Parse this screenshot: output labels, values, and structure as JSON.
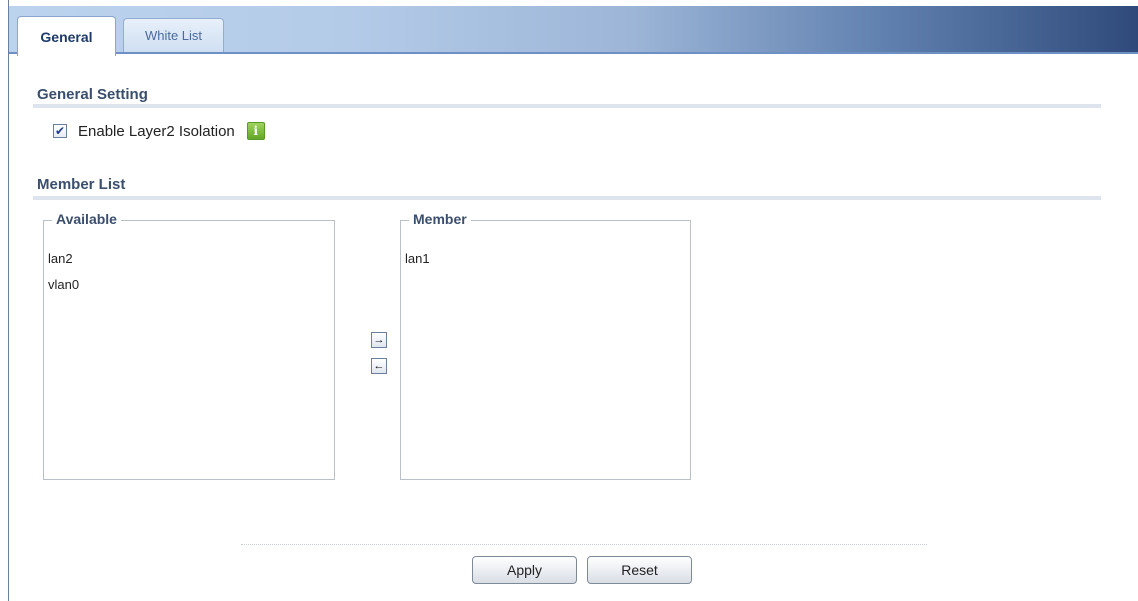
{
  "tabs": [
    {
      "label": "General",
      "active": true
    },
    {
      "label": "White List",
      "active": false
    }
  ],
  "general_setting": {
    "title": "General Setting",
    "enable_label": "Enable Layer2 Isolation",
    "enabled": true,
    "info_icon": "i"
  },
  "member_list": {
    "title": "Member List",
    "available": {
      "legend": "Available",
      "items": [
        "lan2",
        "vlan0"
      ]
    },
    "member": {
      "legend": "Member",
      "items": [
        "lan1"
      ]
    },
    "add_arrow": "→",
    "remove_arrow": "←"
  },
  "buttons": {
    "apply": "Apply",
    "reset": "Reset"
  },
  "colors": {
    "tab_active_text": "#1d3b6b",
    "info_green": "#62a827"
  }
}
